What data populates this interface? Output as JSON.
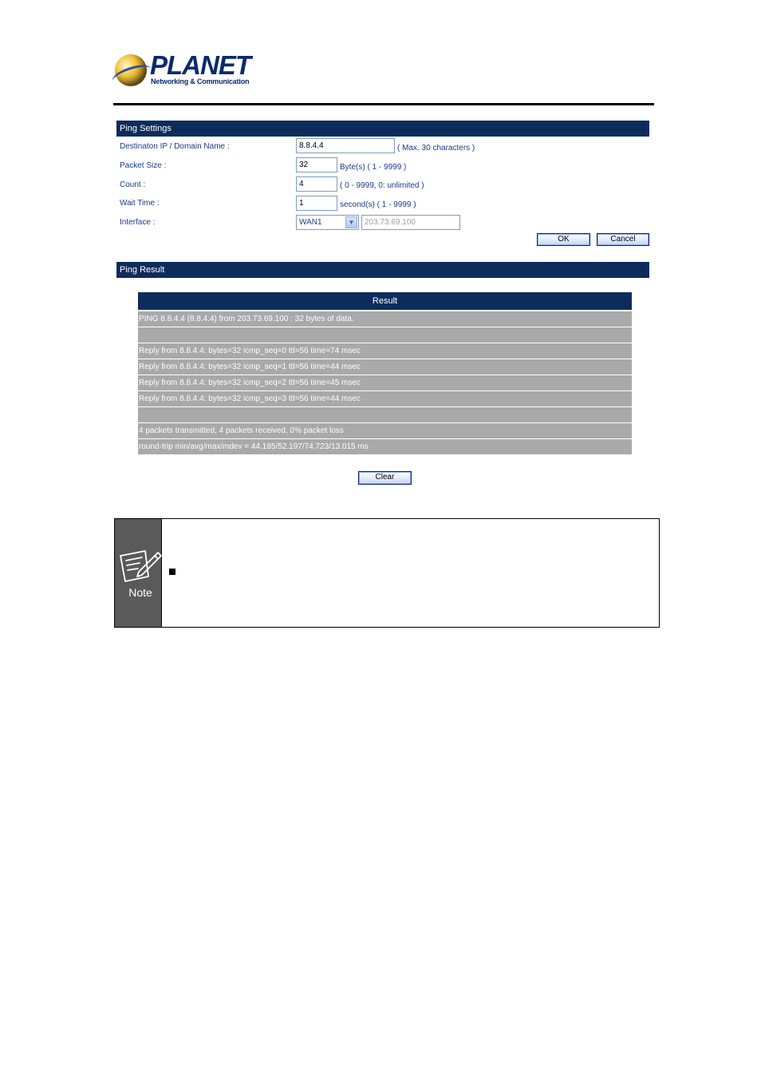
{
  "logo": {
    "brand": "PLANET",
    "tagline": "Networking & Communication"
  },
  "ping_settings": {
    "title": "Ping Settings",
    "destination": {
      "label": "Destinaton IP / Domain Name :",
      "value": "8.8.4.4",
      "hint": "( Max. 30 characters )"
    },
    "packet_size": {
      "label": "Packet Size :",
      "value": "32",
      "hint": "Byte(s) ( 1 - 9999 )"
    },
    "count": {
      "label": "Count :",
      "value": "4",
      "hint": "( 0 - 9999, 0: unlimited )"
    },
    "wait_time": {
      "label": "Wait Time :",
      "value": "1",
      "hint": "second(s) ( 1 - 9999 )"
    },
    "interface": {
      "label": "Interface :",
      "selected": "WAN1",
      "ip": "203.73.69.100"
    },
    "ok_label": "OK",
    "cancel_label": "Cancel"
  },
  "ping_result": {
    "title": "Ping Result",
    "column_header": "Result",
    "rows": [
      "PING 8.8.4.4 (8.8.4.4) from 203.73.69.100 : 32 bytes of data.",
      "",
      "Reply from 8.8.4.4: bytes=32 icmp_seq=0 ttl=56 time=74 msec",
      "Reply from 8.8.4.4: bytes=32 icmp_seq=1 ttl=56 time=44 msec",
      "Reply from 8.8.4.4: bytes=32 icmp_seq=2 ttl=56 time=45 msec",
      "Reply from 8.8.4.4: bytes=32 icmp_seq=3 ttl=56 time=44 msec",
      "",
      "4 packets transmitted, 4 packets received, 0% packet loss",
      "round-trip min/avg/max/mdev = 44.185/52.197/74.723/13.015 ms"
    ],
    "clear_label": "Clear"
  },
  "note": {
    "label": "Note"
  }
}
